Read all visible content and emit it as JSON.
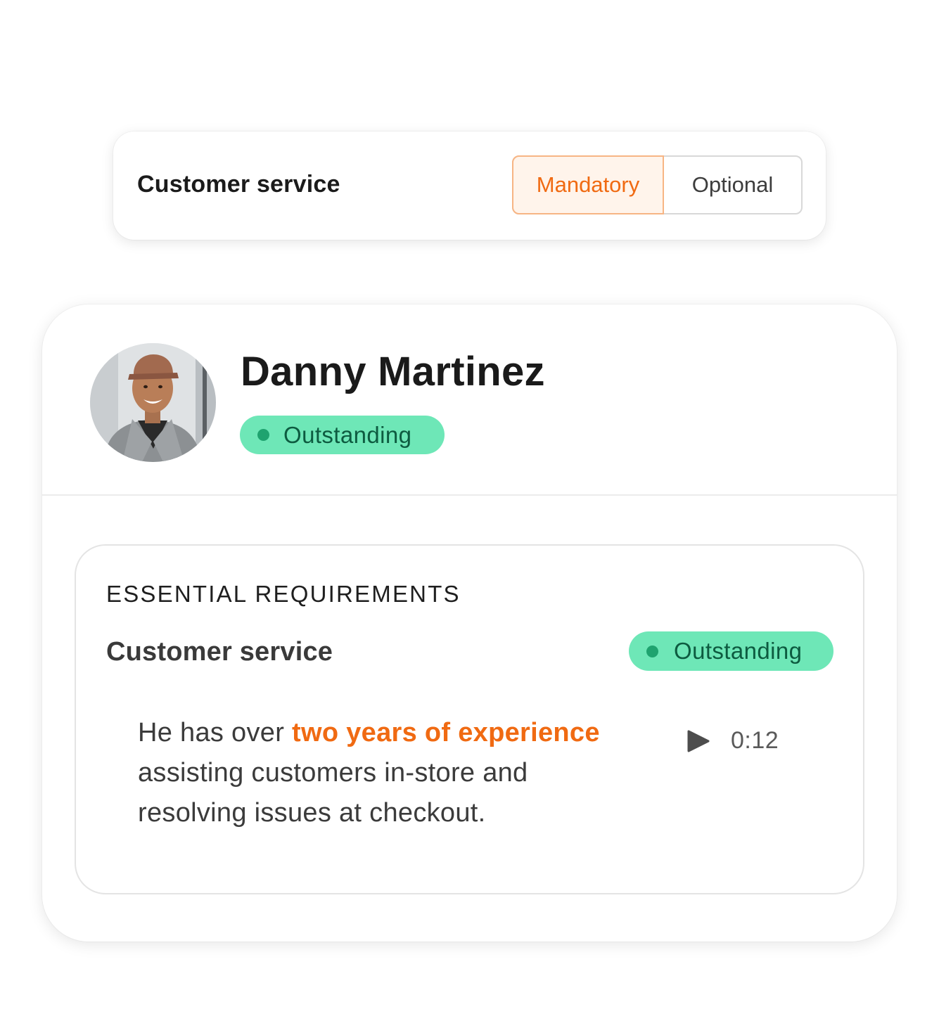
{
  "requirement_card": {
    "title": "Customer service",
    "options": {
      "mandatory": "Mandatory",
      "optional": "Optional"
    },
    "selected": "Mandatory"
  },
  "candidate": {
    "name": "Danny Martinez",
    "rating": "Outstanding",
    "avatar_icon": "person-photo"
  },
  "requirements": {
    "section_label": "ESSENTIAL REQUIREMENTS",
    "skill": "Customer service",
    "rating": "Outstanding",
    "evidence": {
      "before": "He has over ",
      "highlight": "two years of experience",
      "after": " assisting customers in-store and resolving issues at checkout."
    },
    "audio": {
      "icon": "play-icon",
      "duration": "0:12"
    }
  },
  "colors": {
    "accent_orange": "#f06a12",
    "selected_bg": "#fff4eb",
    "badge_bg": "#6ee7b7",
    "badge_dot": "#1fa36f",
    "badge_text": "#0d5b40"
  }
}
